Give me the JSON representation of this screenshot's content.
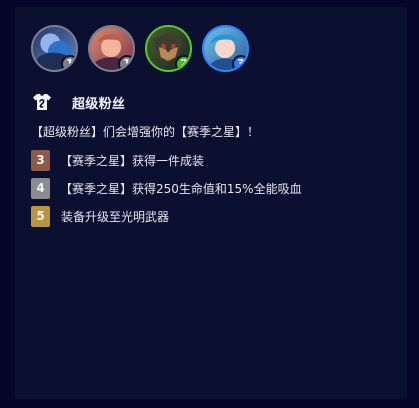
{
  "trait": {
    "name": "超级粉丝",
    "description": "【超级粉丝】们会增强你的【赛季之星】！",
    "icon": "jersey-icon"
  },
  "champions": [
    {
      "name": "champion-1",
      "badge": "1",
      "badge_color": "#7d7f89",
      "portrait_color": "#33417a"
    },
    {
      "name": "champion-2",
      "badge": "1",
      "badge_color": "#7d7f89",
      "portrait_color": "#a34c5d"
    },
    {
      "name": "champion-3",
      "badge": "2",
      "badge_color": "#44b81d",
      "portrait_color": "#3a4c2f"
    },
    {
      "name": "champion-4",
      "badge": "3",
      "badge_color": "#2d7be8",
      "portrait_color": "#2f7fb1"
    }
  ],
  "tiers": [
    {
      "level": "3",
      "color": "#8b5a48",
      "text": "【赛季之星】获得一件成装"
    },
    {
      "level": "4",
      "color": "#8a8d90",
      "text": "【赛季之星】获得250生命值和15%全能吸血"
    },
    {
      "level": "5",
      "color": "#b99443",
      "text": "装备升级至光明武器"
    }
  ]
}
